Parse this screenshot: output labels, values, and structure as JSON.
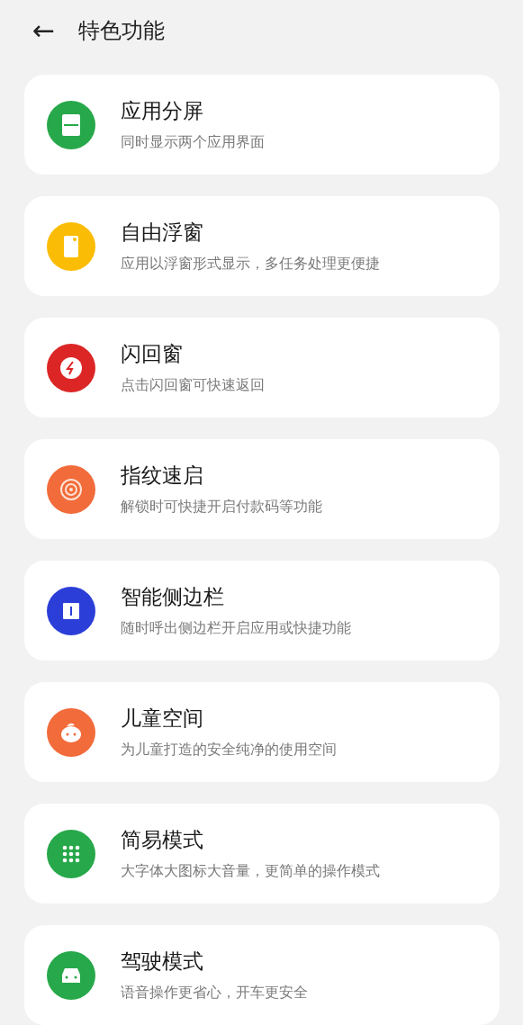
{
  "header": {
    "back": "←",
    "title": "特色功能"
  },
  "features": [
    {
      "title": "应用分屏",
      "subtitle": "同时显示两个应用界面",
      "color": "#27a84a"
    },
    {
      "title": "自由浮窗",
      "subtitle": "应用以浮窗形式显示，多任务处理更便捷",
      "color": "#fbbc05"
    },
    {
      "title": "闪回窗",
      "subtitle": "点击闪回窗可快速返回",
      "color": "#dc2626"
    },
    {
      "title": "指纹速启",
      "subtitle": "解锁时可快捷开启付款码等功能",
      "color": "#f26b3a"
    },
    {
      "title": "智能侧边栏",
      "subtitle": "随时呼出侧边栏开启应用或快捷功能",
      "color": "#2b3fd8"
    },
    {
      "title": "儿童空间",
      "subtitle": "为儿童打造的安全纯净的使用空间",
      "color": "#f26b3a"
    },
    {
      "title": "简易模式",
      "subtitle": "大字体大图标大音量，更简单的操作模式",
      "color": "#27a84a"
    },
    {
      "title": "驾驶模式",
      "subtitle": "语音操作更省心，开车更安全",
      "color": "#27a84a"
    }
  ]
}
